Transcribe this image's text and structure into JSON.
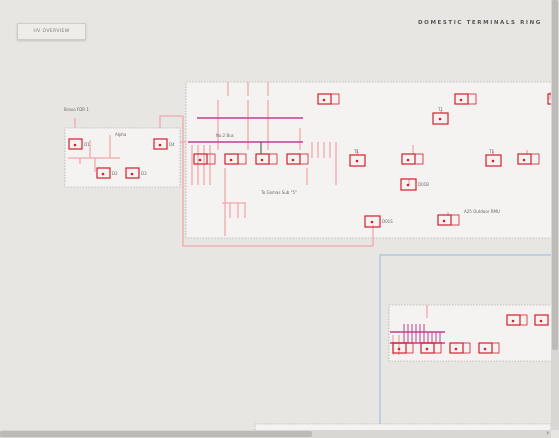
{
  "header": {
    "overview_button": "HV OVERVIEW",
    "title": "DOMESTIC TERMINALS RING"
  },
  "diagram": {
    "labels": {
      "bravo_fdr": "Bravo FDR 1",
      "alpha": "Alpha",
      "no2_bus": "No.2 Bus",
      "to_gomas": "To Gomas Sub \"5\"",
      "a25_outdoor": "A25 Outdoor RMU",
      "d1": "D1",
      "d2": "D2",
      "d3": "D3",
      "d4": "D4",
      "t1a": "T1",
      "t1b": "T1",
      "t1c": "T1",
      "d01b": "D01B",
      "d01s": "D01S"
    }
  },
  "colors": {
    "background": "#e8e6e2",
    "panel": "#f4f3f1",
    "feeder_pink": "#f2a8ac",
    "busbar_magenta": "#c0408f",
    "breaker_red": "#d21f2b",
    "cable_blue": "#a9c4e4"
  },
  "scrollbars": {
    "right_arrow": "›"
  }
}
